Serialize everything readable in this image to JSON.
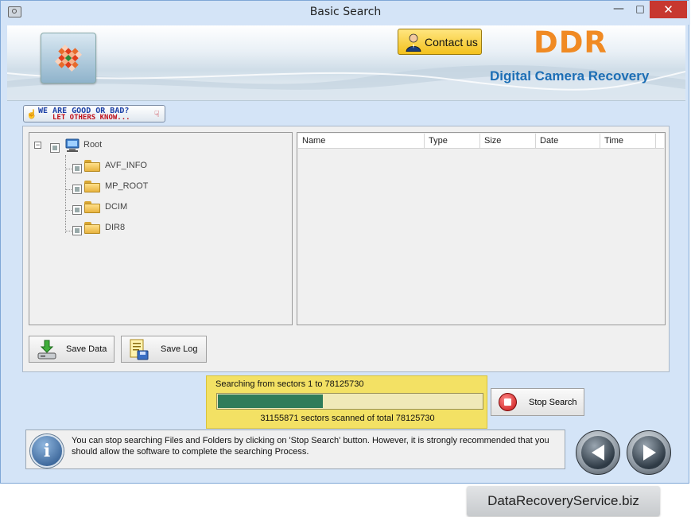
{
  "window": {
    "title": "Basic Search",
    "controls": {
      "minimize": "—",
      "maximize": "□",
      "close": "✕"
    }
  },
  "header": {
    "contact_label": "Contact us",
    "brand": "DDR",
    "product": "Digital Camera Recovery"
  },
  "feedback": {
    "line1": "WE ARE GOOD OR BAD?",
    "line2": "LET OTHERS KNOW..."
  },
  "tree": {
    "root": {
      "label": "Root",
      "expanded": true
    },
    "items": [
      {
        "label": "AVF_INFO"
      },
      {
        "label": "MP_ROOT"
      },
      {
        "label": "DCIM"
      },
      {
        "label": "DIR8"
      }
    ]
  },
  "file_list": {
    "columns": [
      "Name",
      "Type",
      "Size",
      "Date",
      "Time"
    ]
  },
  "actions": {
    "save_data": "Save Data",
    "save_log": "Save Log"
  },
  "progress": {
    "status": "Searching from sectors  1 to 78125730",
    "scanned": "31155871  sectors scanned of total 78125730",
    "fraction": 0.3988
  },
  "stop_search": "Stop Search",
  "info": {
    "message": "You can stop searching Files and Folders by clicking on 'Stop Search' button. However, it is strongly recommended that you should allow the software to complete the searching Process."
  },
  "footer": {
    "site": "DataRecoveryService.biz"
  },
  "colors": {
    "brand": "#f08a23",
    "product": "#1c6eb5",
    "progress_bg": "#f3e164",
    "progress_fill": "#2f7c5a",
    "close_button": "#c7372f"
  }
}
